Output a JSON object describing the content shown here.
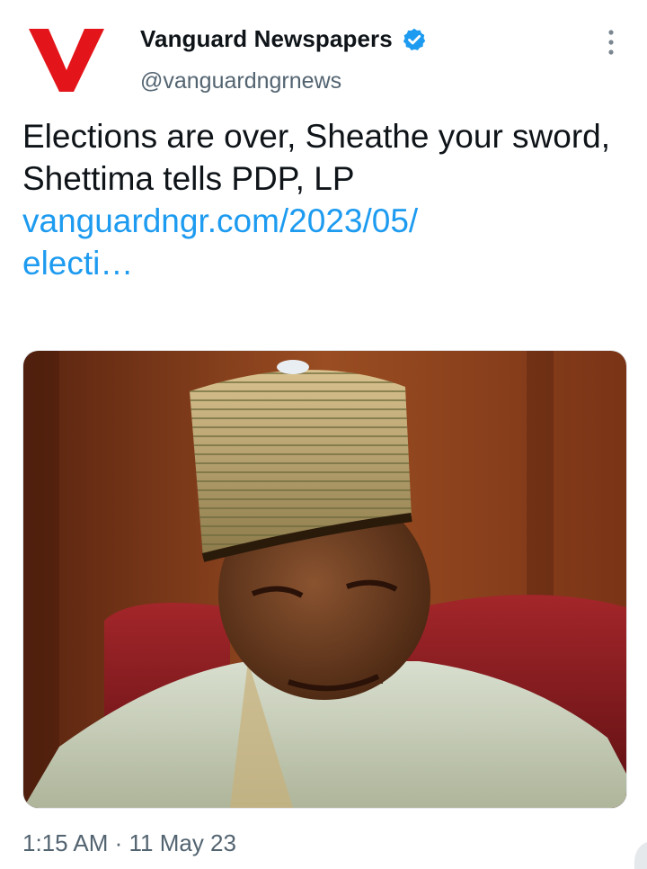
{
  "header": {
    "display_name": "Vanguard Newspapers",
    "handle": "@vanguardngrnews",
    "logo_letter": "V",
    "logo_color": "#e3151a",
    "verified_color": "#1d9bf0"
  },
  "tweet": {
    "text": "Elections are over, Sheathe your sword, Shettima tells PDP, LP",
    "link_line1": "vanguardngr.com/2023/05/",
    "link_line2": "electi…",
    "timestamp": "1:15 AM · 11 May 23"
  },
  "icons": {
    "more": "more-vertical-icon",
    "verified": "verified-badge-icon"
  },
  "colors": {
    "link": "#1d9bf0",
    "secondary_text": "#536471",
    "primary_text": "#0f1419"
  }
}
